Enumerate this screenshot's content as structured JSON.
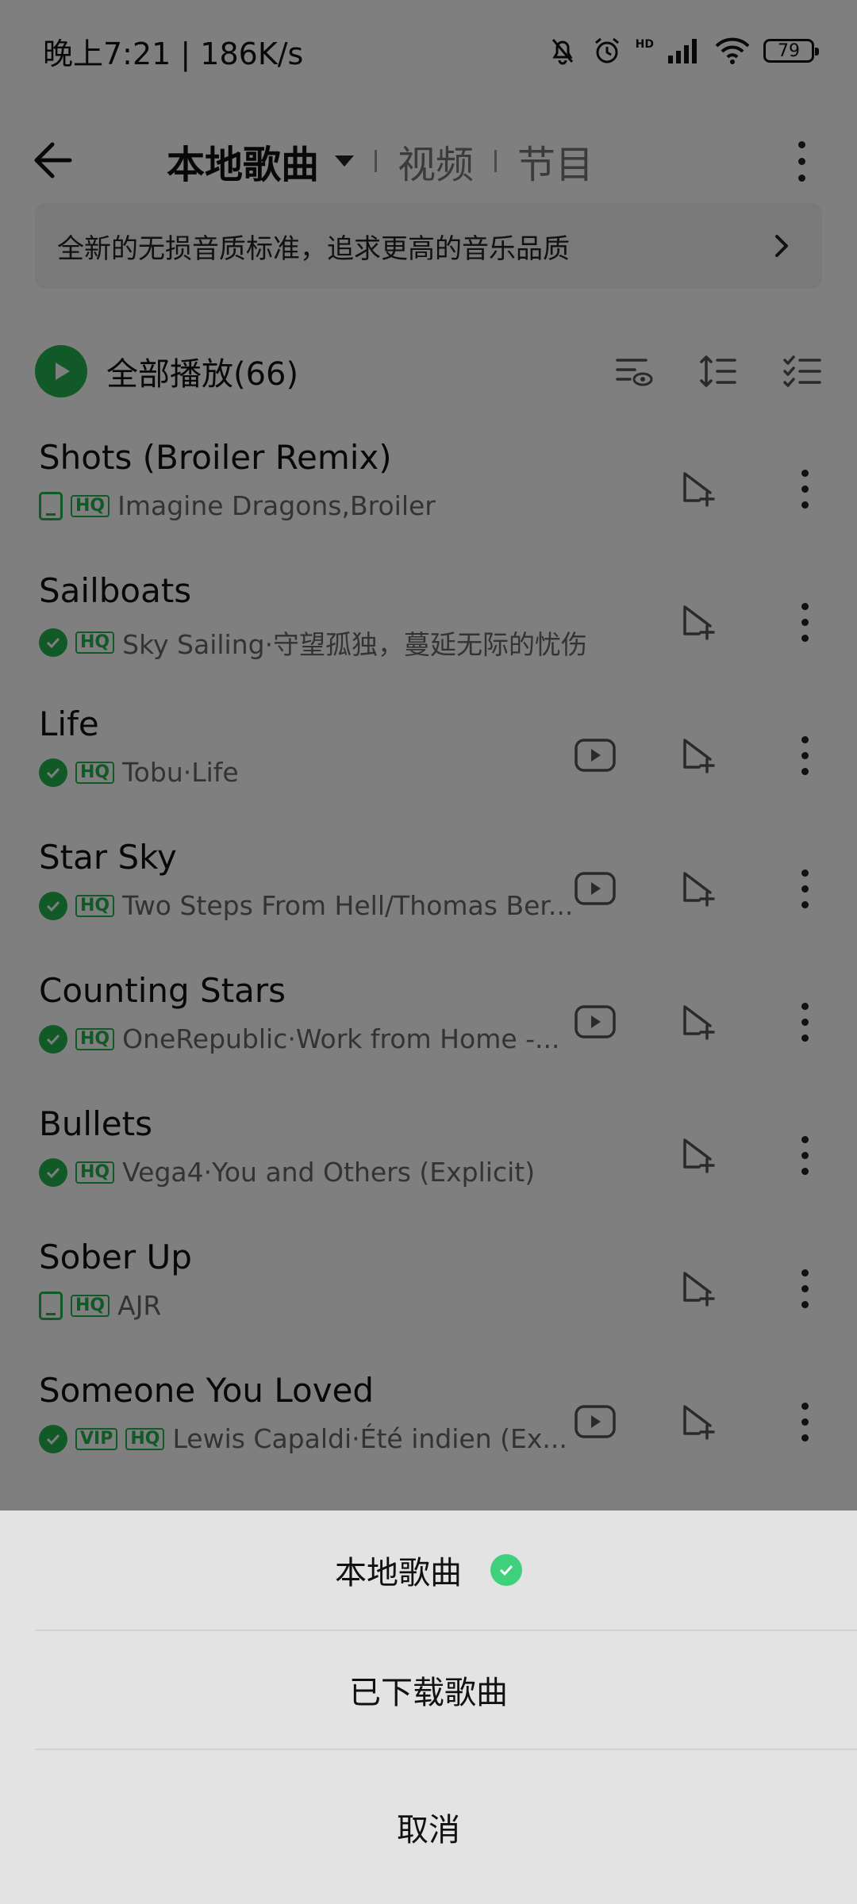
{
  "status_bar": {
    "time_speed": "晚上7:21 | 186K/s",
    "battery": "79",
    "network_label": "HD"
  },
  "header": {
    "tabs": [
      {
        "label": "本地歌曲"
      },
      {
        "label": "视频"
      },
      {
        "label": "节目"
      }
    ]
  },
  "banner": {
    "text": "全新的无损音质标准，追求更高的音乐品质"
  },
  "play_all": {
    "label": "全部播放(66)"
  },
  "songs": [
    {
      "title": "Shots (Broiler Remix)",
      "subtitle": "Imagine Dragons,Broiler",
      "status": "device",
      "vip": false,
      "has_mv": false
    },
    {
      "title": "Sailboats",
      "subtitle": "Sky Sailing·守望孤独，蔓延无际的忧伤",
      "status": "downloaded",
      "vip": false,
      "has_mv": false
    },
    {
      "title": "Life",
      "subtitle": "Tobu·Life",
      "status": "downloaded",
      "vip": false,
      "has_mv": true
    },
    {
      "title": "Star Sky",
      "subtitle": "Two Steps From Hell/Thomas Ber...",
      "status": "downloaded",
      "vip": false,
      "has_mv": true
    },
    {
      "title": "Counting Stars",
      "subtitle": "OneRepublic·Work from Home -...",
      "status": "downloaded",
      "vip": false,
      "has_mv": true
    },
    {
      "title": "Bullets",
      "subtitle": "Vega4·You and Others (Explicit)",
      "status": "downloaded",
      "vip": false,
      "has_mv": false
    },
    {
      "title": "Sober Up",
      "subtitle": "AJR",
      "status": "device",
      "vip": false,
      "has_mv": false
    },
    {
      "title": "Someone You Loved",
      "subtitle": "Lewis Capaldi·Été indien (Ex...",
      "status": "downloaded",
      "vip": true,
      "has_mv": true
    }
  ],
  "badges": {
    "hq": "HQ",
    "vip": "VIP"
  },
  "bottom_sheet": {
    "options": [
      {
        "label": "本地歌曲",
        "selected": true
      },
      {
        "label": "已下载歌曲",
        "selected": false
      }
    ],
    "cancel_label": "取消"
  },
  "colors": {
    "accent_green": "#22b24c",
    "check_green": "#3ed07a",
    "sheet_bg": "#e3e3e3"
  }
}
